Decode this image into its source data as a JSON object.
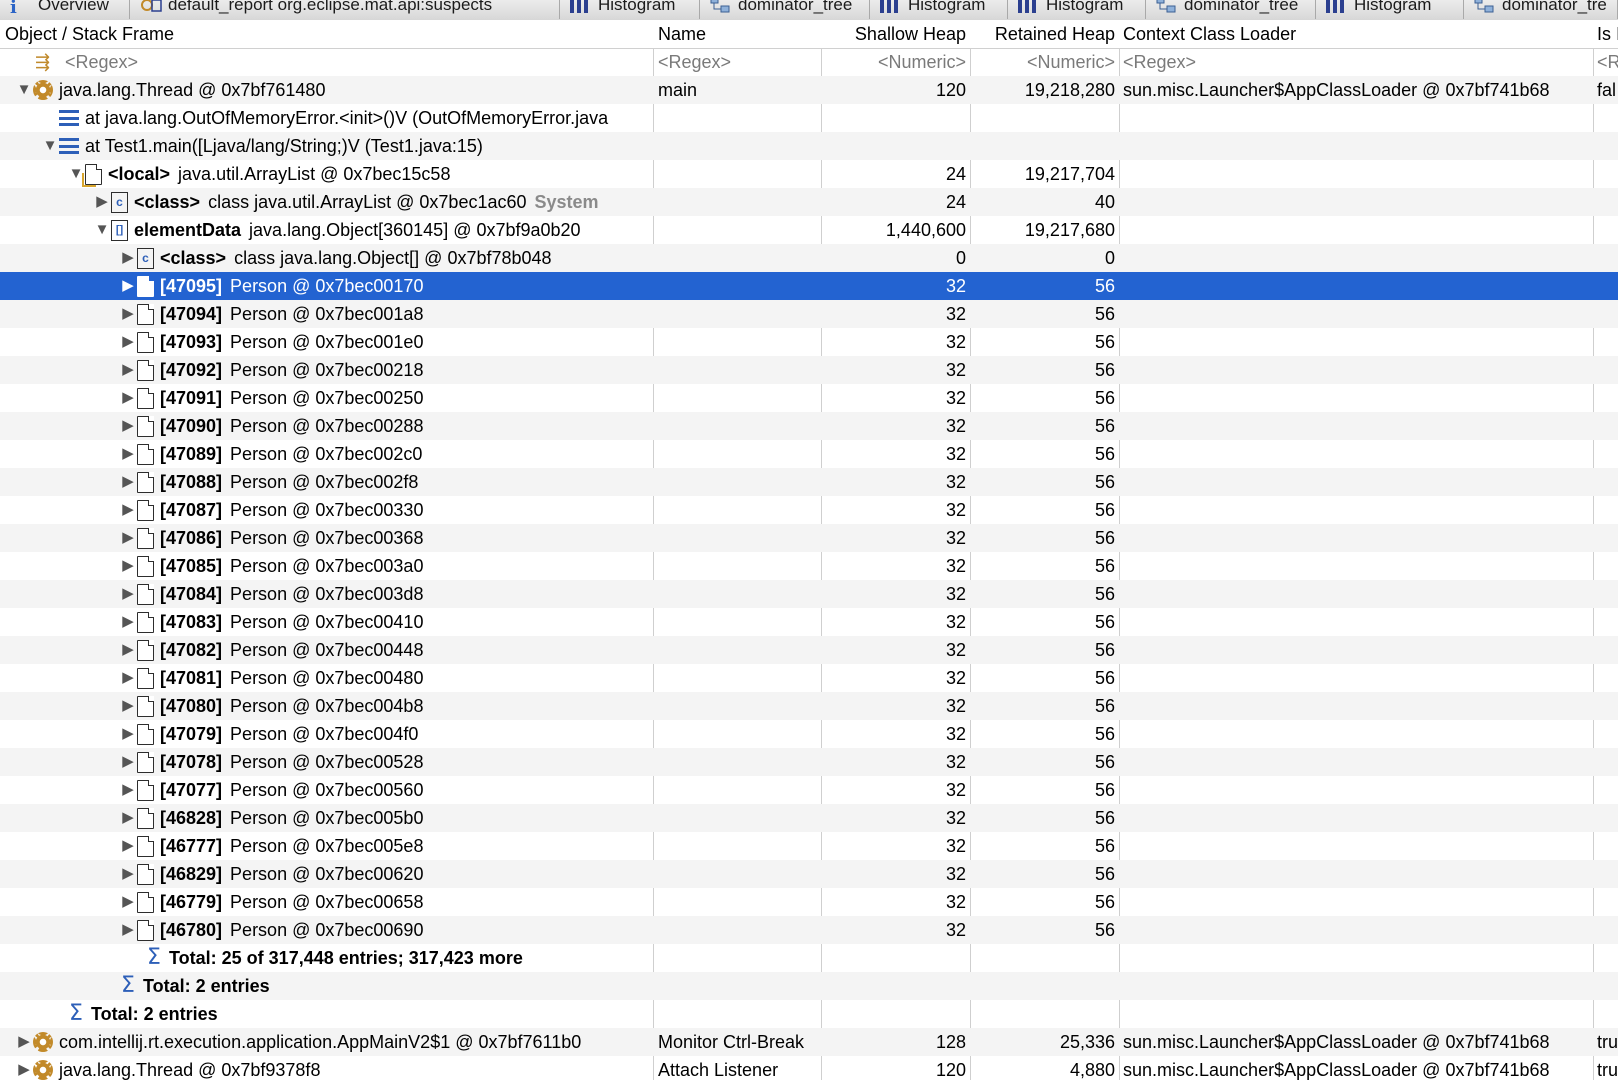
{
  "tabs": [
    {
      "label": "Overview",
      "icon": "info-icon"
    },
    {
      "label": "default_report  org.eclipse.mat.api:suspects",
      "icon": "report-icon"
    },
    {
      "label": "Histogram",
      "icon": "histogram-icon"
    },
    {
      "label": "dominator_tree",
      "icon": "tree-icon"
    },
    {
      "label": "Histogram",
      "icon": "histogram-icon"
    },
    {
      "label": "Histogram",
      "icon": "histogram-icon"
    },
    {
      "label": "dominator_tree",
      "icon": "tree-icon"
    },
    {
      "label": "Histogram",
      "icon": "histogram-icon"
    },
    {
      "label": "dominator_tre",
      "icon": "tree-icon"
    }
  ],
  "columns": {
    "object": "Object / Stack Frame",
    "name": "Name",
    "shallow": "Shallow Heap",
    "retained": "Retained Heap",
    "loader": "Context Class Loader",
    "is": "Is I"
  },
  "filters": {
    "object": "<Regex>",
    "name": "<Regex>",
    "shallow": "<Numeric>",
    "retained": "<Numeric>",
    "loader": "<Regex>",
    "is": "<R"
  },
  "thread": {
    "label": "java.lang.Thread @ 0x7bf761480",
    "name": "main",
    "shallow": "120",
    "retained": "19,218,280",
    "loader": "sun.misc.Launcher$AppClassLoader @ 0x7bf741b68",
    "is": "fal"
  },
  "frame1": "at java.lang.OutOfMemoryError.<init>()V (OutOfMemoryError.java",
  "frame2": "at Test1.main([Ljava/lang/String;)V (Test1.java:15)",
  "local": {
    "tag": "<local>",
    "label": "java.util.ArrayList @ 0x7bec15c58",
    "shallow": "24",
    "retained": "19,217,704"
  },
  "classRef": {
    "tag": "<class>",
    "label": "class java.util.ArrayList @ 0x7bec1ac60",
    "extra": "System",
    "shallow": "24",
    "retained": "40"
  },
  "elementData": {
    "tag": "elementData",
    "label": "java.lang.Object[360145] @ 0x7bf9a0b20",
    "shallow": "1,440,600",
    "retained": "19,217,680"
  },
  "objClass": {
    "tag": "<class>",
    "label": "class java.lang.Object[] @ 0x7bf78b048",
    "shallow": "0",
    "retained": "0"
  },
  "entries": [
    {
      "index": "[47095]",
      "label": "Person @ 0x7bec00170",
      "shallow": "32",
      "retained": "56"
    },
    {
      "index": "[47094]",
      "label": "Person @ 0x7bec001a8",
      "shallow": "32",
      "retained": "56"
    },
    {
      "index": "[47093]",
      "label": "Person @ 0x7bec001e0",
      "shallow": "32",
      "retained": "56"
    },
    {
      "index": "[47092]",
      "label": "Person @ 0x7bec00218",
      "shallow": "32",
      "retained": "56"
    },
    {
      "index": "[47091]",
      "label": "Person @ 0x7bec00250",
      "shallow": "32",
      "retained": "56"
    },
    {
      "index": "[47090]",
      "label": "Person @ 0x7bec00288",
      "shallow": "32",
      "retained": "56"
    },
    {
      "index": "[47089]",
      "label": "Person @ 0x7bec002c0",
      "shallow": "32",
      "retained": "56"
    },
    {
      "index": "[47088]",
      "label": "Person @ 0x7bec002f8",
      "shallow": "32",
      "retained": "56"
    },
    {
      "index": "[47087]",
      "label": "Person @ 0x7bec00330",
      "shallow": "32",
      "retained": "56"
    },
    {
      "index": "[47086]",
      "label": "Person @ 0x7bec00368",
      "shallow": "32",
      "retained": "56"
    },
    {
      "index": "[47085]",
      "label": "Person @ 0x7bec003a0",
      "shallow": "32",
      "retained": "56"
    },
    {
      "index": "[47084]",
      "label": "Person @ 0x7bec003d8",
      "shallow": "32",
      "retained": "56"
    },
    {
      "index": "[47083]",
      "label": "Person @ 0x7bec00410",
      "shallow": "32",
      "retained": "56"
    },
    {
      "index": "[47082]",
      "label": "Person @ 0x7bec00448",
      "shallow": "32",
      "retained": "56"
    },
    {
      "index": "[47081]",
      "label": "Person @ 0x7bec00480",
      "shallow": "32",
      "retained": "56"
    },
    {
      "index": "[47080]",
      "label": "Person @ 0x7bec004b8",
      "shallow": "32",
      "retained": "56"
    },
    {
      "index": "[47079]",
      "label": "Person @ 0x7bec004f0",
      "shallow": "32",
      "retained": "56"
    },
    {
      "index": "[47078]",
      "label": "Person @ 0x7bec00528",
      "shallow": "32",
      "retained": "56"
    },
    {
      "index": "[47077]",
      "label": "Person @ 0x7bec00560",
      "shallow": "32",
      "retained": "56"
    },
    {
      "index": "[46828]",
      "label": "Person @ 0x7bec005b0",
      "shallow": "32",
      "retained": "56"
    },
    {
      "index": "[46777]",
      "label": "Person @ 0x7bec005e8",
      "shallow": "32",
      "retained": "56"
    },
    {
      "index": "[46829]",
      "label": "Person @ 0x7bec00620",
      "shallow": "32",
      "retained": "56"
    },
    {
      "index": "[46779]",
      "label": "Person @ 0x7bec00658",
      "shallow": "32",
      "retained": "56"
    },
    {
      "index": "[46780]",
      "label": "Person @ 0x7bec00690",
      "shallow": "32",
      "retained": "56"
    }
  ],
  "selectedIndex": 0,
  "totals": {
    "entries": "Total: 25 of 317,448 entries; 317,423 more",
    "inner": "Total: 2 entries",
    "outer": "Total: 2 entries"
  },
  "thread2": {
    "label": "com.intellij.rt.execution.application.AppMainV2$1 @ 0x7bf7611b0",
    "name": "Monitor Ctrl-Break",
    "shallow": "128",
    "retained": "25,336",
    "loader": "sun.misc.Launcher$AppClassLoader @ 0x7bf741b68",
    "is": "tru"
  },
  "thread3": {
    "label": "java.lang.Thread @ 0x7bf9378f8",
    "name": "Attach Listener",
    "shallow": "120",
    "retained": "4,880",
    "loader": "sun.misc.Launcher$AppClassLoader @ 0x7bf741b68",
    "is": "tru"
  },
  "colors": {
    "selection": "#2363d1",
    "accent": "#2d5fb8",
    "gear": "#c28a2a"
  }
}
